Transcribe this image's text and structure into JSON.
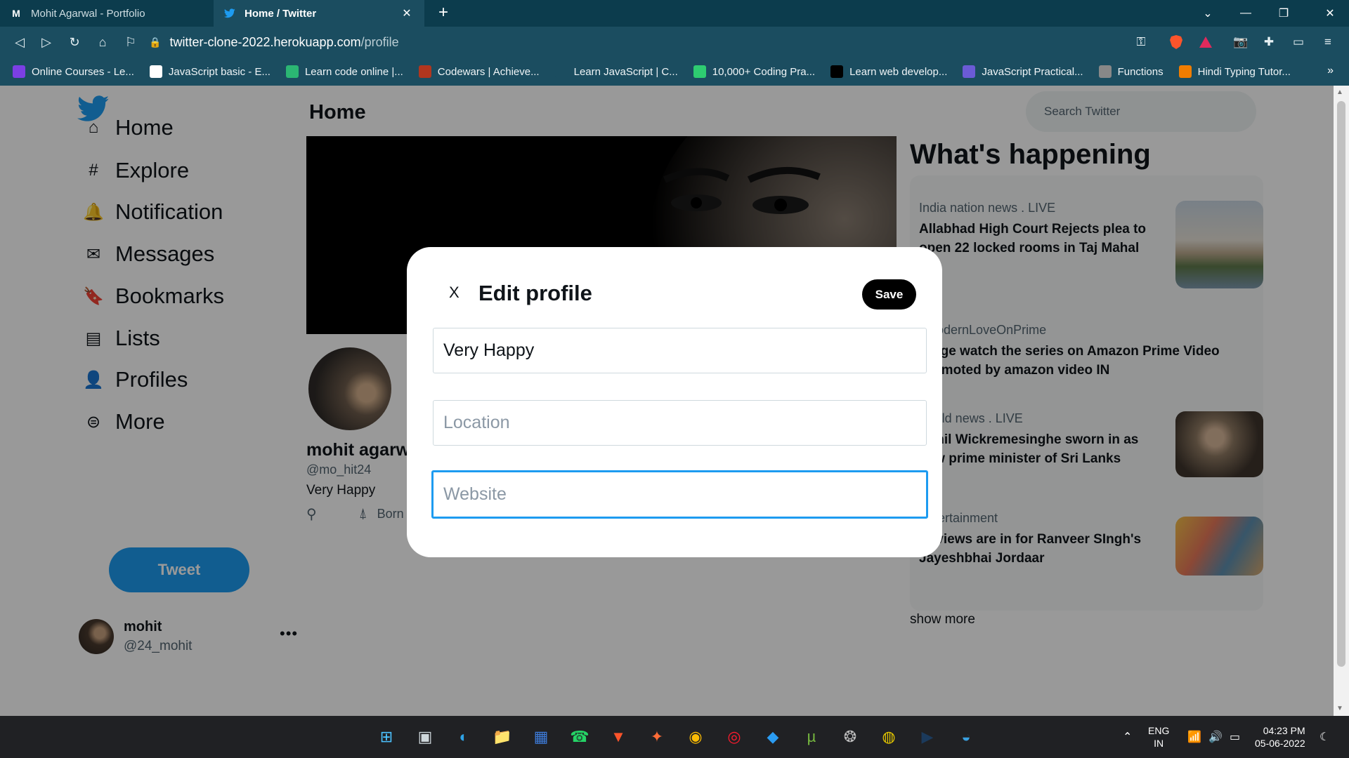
{
  "browser": {
    "tabs": [
      {
        "title": "Mohit Agarwal - Portfolio",
        "active": false
      },
      {
        "title": "Home / Twitter",
        "active": true
      }
    ],
    "url_host": "twitter-clone-2022.herokuapp.com",
    "url_path": "/profile",
    "bookmarks": [
      {
        "label": "Online Courses - Le...",
        "color": "#7b3fe4",
        "icon": "udemy-icon"
      },
      {
        "label": "JavaScript basic - E...",
        "color": "#ffffff",
        "icon": "w3resource-icon"
      },
      {
        "label": "Learn code online |...",
        "color": "#2bb673",
        "icon": "code-brackets-icon"
      },
      {
        "label": "Codewars | Achieve...",
        "color": "#b1361e",
        "icon": "codewars-icon"
      },
      {
        "label": "Learn JavaScript | C...",
        "color": "#1b4d60",
        "icon": "codecademy-icon"
      },
      {
        "label": "10,000+ Coding Pra...",
        "color": "#2ecc71",
        "icon": "edabit-icon"
      },
      {
        "label": "Learn web develop...",
        "color": "#000000",
        "icon": "mdn-icon"
      },
      {
        "label": "JavaScript Practical...",
        "color": "#6b5bd6",
        "icon": "practical-icon"
      },
      {
        "label": "Functions",
        "color": "#888888",
        "icon": "globe-icon"
      },
      {
        "label": "Hindi Typing Tutor...",
        "color": "#f07d00",
        "icon": "typing-icon"
      }
    ]
  },
  "sidebar": {
    "items": [
      {
        "label": "Home",
        "icon": "home-icon",
        "glyph": "⌂"
      },
      {
        "label": "Explore",
        "icon": "hashtag-icon",
        "glyph": "#"
      },
      {
        "label": "Notification",
        "icon": "bell-icon",
        "glyph": "🔔"
      },
      {
        "label": "Messages",
        "icon": "envelope-icon",
        "glyph": "✉"
      },
      {
        "label": "Bookmarks",
        "icon": "bookmark-icon",
        "glyph": "🔖"
      },
      {
        "label": "Lists",
        "icon": "list-document-icon",
        "glyph": "▤"
      },
      {
        "label": "Profiles",
        "icon": "person-icon",
        "glyph": "👤"
      },
      {
        "label": "More",
        "icon": "more-circle-icon",
        "glyph": "⊜"
      }
    ],
    "tweet_label": "Tweet",
    "user_name": "mohit",
    "user_handle": "@24_mohit",
    "more_dots": "•••"
  },
  "center": {
    "title": "Home",
    "profile_name": "mohit agarwal",
    "profile_handle": "@mo_hit24",
    "profile_bio": "Very Happy",
    "profile_born": "Born"
  },
  "right": {
    "search_placeholder": "Search Twitter",
    "section_title": "What's happening",
    "trends": [
      {
        "category": "India nation news . LIVE",
        "headline": "Allabhad High Court Rejects plea to open 22 locked rooms in Taj Mahal",
        "has_image": true
      },
      {
        "category": "#ModernLoveOnPrime",
        "headline": "Binge watch the series on Amazon Prime Video Promoted by amazon video IN",
        "has_image": false
      },
      {
        "category": "World news . LIVE",
        "headline": "Ranil Wickremesinghe sworn in as new prime minister of Sri Lanks",
        "has_image": true
      },
      {
        "category": "Entertainment",
        "headline": "Reviews are in for Ranveer SIngh's Jayeshbhai Jordaar",
        "has_image": true
      }
    ],
    "show_more": "show more"
  },
  "modal": {
    "close_label": "X",
    "title": "Edit profile",
    "save_label": "Save",
    "bio_value": "Very Happy",
    "location_placeholder": "Location",
    "website_placeholder": "Website"
  },
  "taskbar": {
    "language": "ENG",
    "region": "IN",
    "time": "04:23 PM",
    "date": "05-06-2022",
    "apps": [
      "start-icon",
      "task-view-icon",
      "edge-icon",
      "file-explorer-icon",
      "store-icon",
      "whatsapp-icon",
      "brave-icon",
      "postman-icon",
      "chrome-icon",
      "opera-icon",
      "vscode-icon",
      "utorrent-icon",
      "media-player-icon",
      "app-icon",
      "prime-video-icon",
      "browser-icon"
    ]
  },
  "colors": {
    "twitter_blue": "#1d9bf0",
    "browser_chrome": "#1b4d60",
    "taskbar": "#202124"
  }
}
